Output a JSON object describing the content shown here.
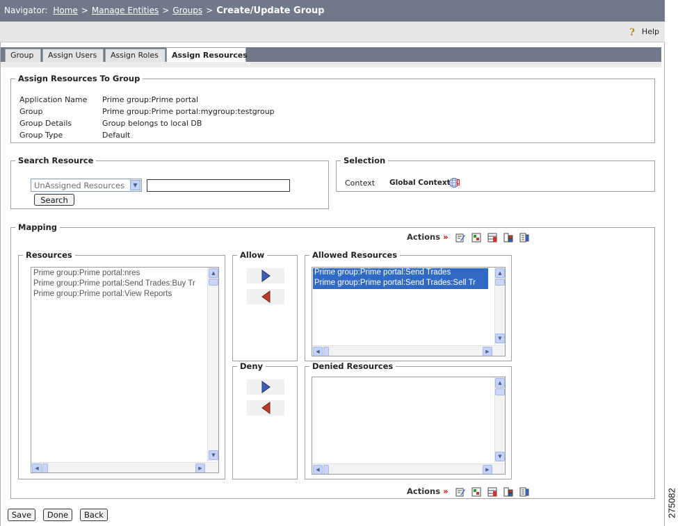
{
  "navigator": {
    "label": "Navigator:",
    "crumbs": [
      "Home",
      "Manage Entities",
      "Groups"
    ],
    "separator": ">",
    "current": "Create/Update Group"
  },
  "help_label": "Help",
  "tabs": [
    "Group",
    "Assign Users",
    "Assign Roles",
    "Assign Resources"
  ],
  "active_tab": "Assign Resources",
  "assign": {
    "legend": "Assign Resources To Group",
    "rows": [
      {
        "label": "Application Name",
        "value": "Prime group:Prime portal"
      },
      {
        "label": "Group",
        "value": "Prime group:Prime portal:mygroup:testgroup"
      },
      {
        "label": "Group Details",
        "value": "Group belongs to local DB"
      },
      {
        "label": "Group Type",
        "value": "Default"
      }
    ]
  },
  "search": {
    "legend": "Search Resource",
    "filter_selected": "UnAssigned Resources",
    "input_value": "",
    "button": "Search"
  },
  "selection": {
    "legend": "Selection",
    "context_label": "Context",
    "context_value": "Global Context"
  },
  "mapping": {
    "legend": "Mapping",
    "actions_label": "Actions",
    "actions_arrow": "»",
    "resources_legend": "Resources",
    "resources": [
      "Prime group:Prime portal:nres",
      "Prime group:Prime portal:Send Trades:Buy Tr",
      "Prime group:Prime portal:View Reports"
    ],
    "allow_legend": "Allow",
    "deny_legend": "Deny",
    "allowed_legend": "Allowed Resources",
    "allowed": [
      "Prime group:Prime portal:Send Trades",
      "Prime group:Prime portal:Send Trades:Sell Tr"
    ],
    "denied_legend": "Denied Resources",
    "denied": []
  },
  "buttons": {
    "save": "Save",
    "done": "Done",
    "back": "Back"
  },
  "figure_id": "275082",
  "colors": {
    "navbar": "#6f7987",
    "selected": "#316ac5",
    "arrow_right": "#3b5fb5",
    "arrow_left": "#c0392b"
  }
}
